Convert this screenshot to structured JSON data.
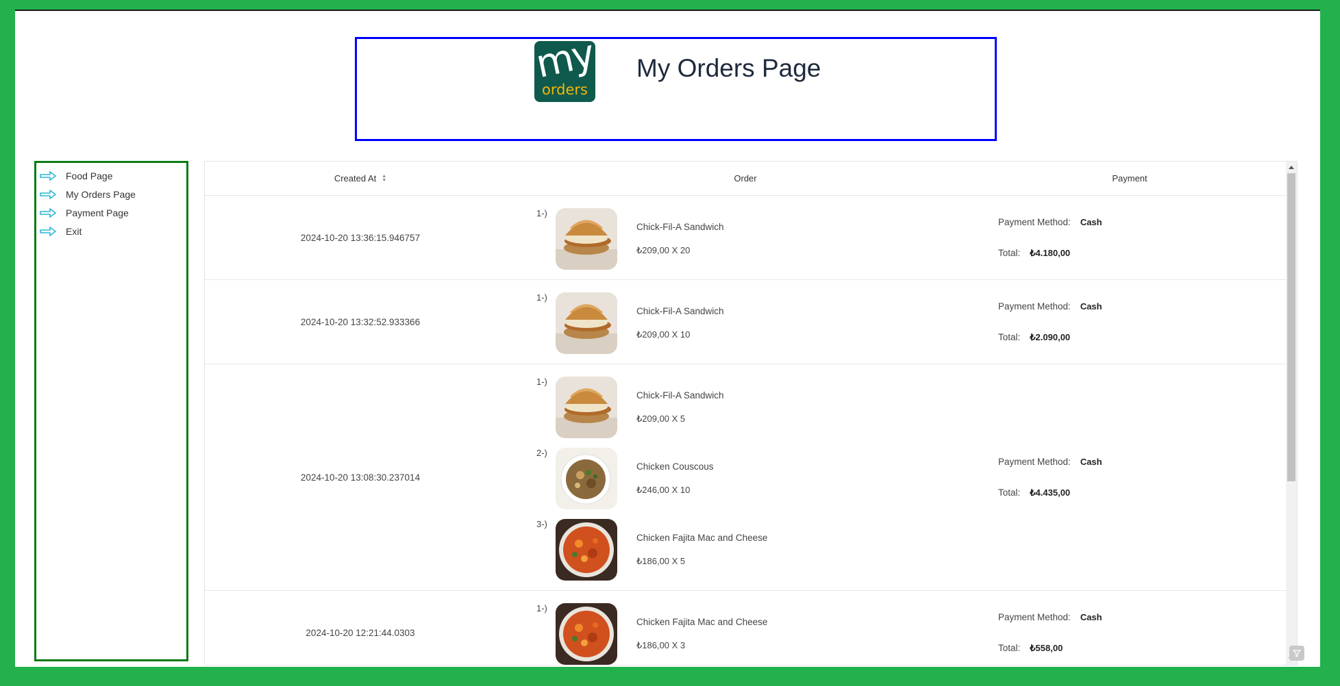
{
  "header": {
    "title": "My Orders Page",
    "logo_top": "my",
    "logo_bottom": "orders"
  },
  "sidebar": {
    "items": [
      {
        "label": "Food Page",
        "icon": "arrow-right-icon"
      },
      {
        "label": "My Orders Page",
        "icon": "arrow-right-icon"
      },
      {
        "label": "Payment Page",
        "icon": "arrow-right-icon"
      },
      {
        "label": "Exit",
        "icon": "arrow-right-icon"
      }
    ]
  },
  "table": {
    "columns": [
      "Created At",
      "Order",
      "Payment"
    ],
    "payment_method_label": "Payment Method:",
    "total_label": "Total:",
    "rows": [
      {
        "created_at": "2024-10-20 13:36:15.946757",
        "items": [
          {
            "index": "1-)",
            "name": "Chick-Fil-A Sandwich",
            "price": "₺209,00 X 20",
            "image": "sandwich"
          }
        ],
        "payment_method": "Cash",
        "total": "₺4.180,00"
      },
      {
        "created_at": "2024-10-20 13:32:52.933366",
        "items": [
          {
            "index": "1-)",
            "name": "Chick-Fil-A Sandwich",
            "price": "₺209,00 X 10",
            "image": "sandwich"
          }
        ],
        "payment_method": "Cash",
        "total": "₺2.090,00"
      },
      {
        "created_at": "2024-10-20 13:08:30.237014",
        "items": [
          {
            "index": "1-)",
            "name": "Chick-Fil-A Sandwich",
            "price": "₺209,00 X 5",
            "image": "sandwich"
          },
          {
            "index": "2-)",
            "name": "Chicken Couscous",
            "price": "₺246,00 X 10",
            "image": "couscous"
          },
          {
            "index": "3-)",
            "name": "Chicken Fajita Mac and Cheese",
            "price": "₺186,00 X 5",
            "image": "fajita"
          }
        ],
        "payment_method": "Cash",
        "total": "₺4.435,00"
      },
      {
        "created_at": "2024-10-20 12:21:44.0303",
        "items": [
          {
            "index": "1-)",
            "name": "Chicken Fajita Mac and Cheese",
            "price": "₺186,00 X 3",
            "image": "fajita"
          }
        ],
        "payment_method": "Cash",
        "total": "₺558,00"
      }
    ]
  },
  "colors": {
    "background": "#22b14c",
    "header_border": "#0000ff",
    "sidebar_border": "#0a7a12",
    "arrow": "#29b6d6",
    "logo_bg": "#0f5a4c",
    "logo_accent": "#f5b50c"
  }
}
